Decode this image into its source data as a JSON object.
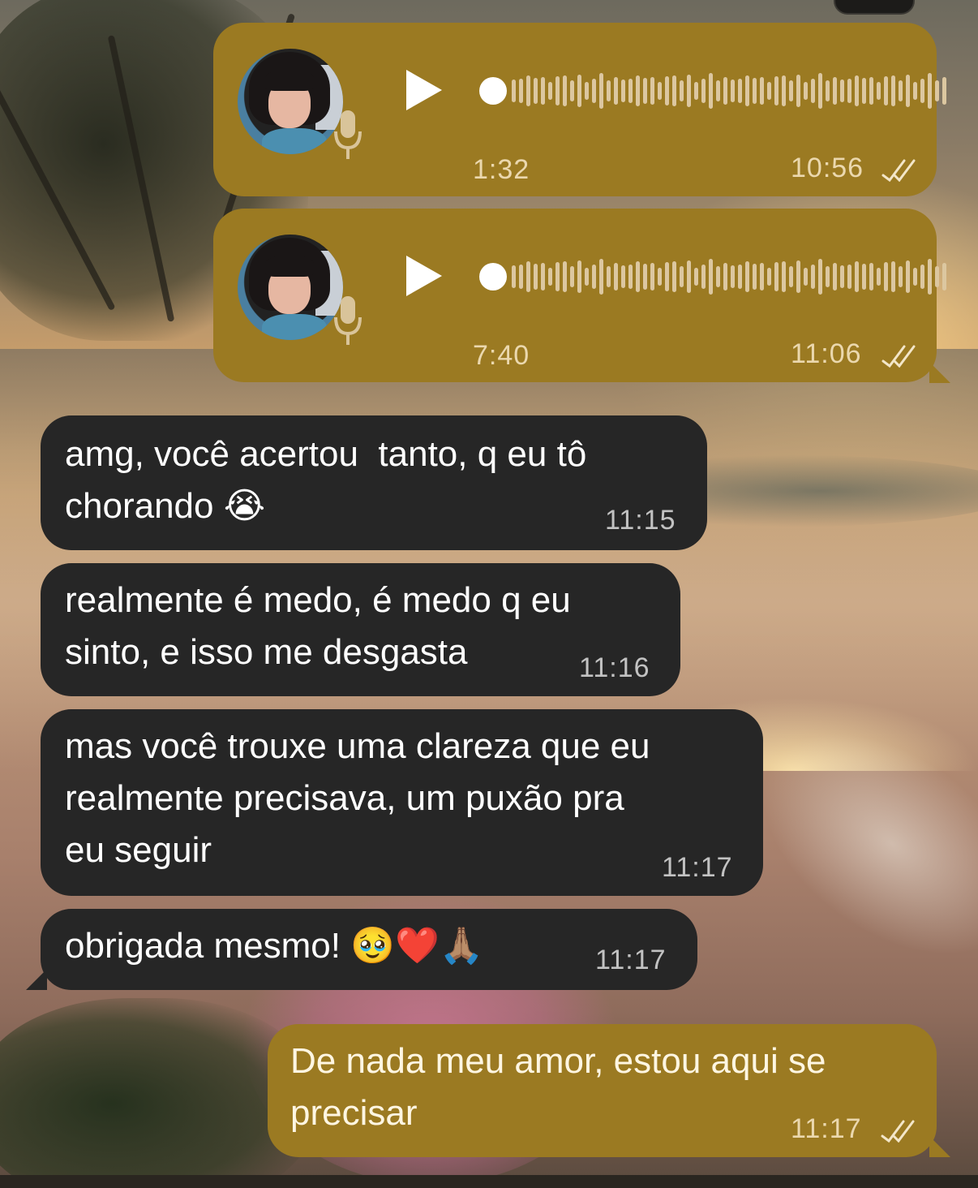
{
  "colors": {
    "outgoing_bubble": "#9b7a22",
    "incoming_bubble": "#262626",
    "text": "#ffffff",
    "waveform": "#dcc7a0"
  },
  "messages": [
    {
      "type": "voice",
      "direction": "outgoing",
      "duration": "1:32",
      "time": "10:56",
      "status": "double-check-icon",
      "progress": 0
    },
    {
      "type": "voice",
      "direction": "outgoing",
      "duration": "7:40",
      "time": "11:06",
      "status": "double-check-icon",
      "progress": 0
    },
    {
      "type": "text",
      "direction": "incoming",
      "text": "amg, você acertou  tanto, q eu tô\nchorando 😭",
      "time": "11:15"
    },
    {
      "type": "text",
      "direction": "incoming",
      "text": "realmente é medo, é medo q eu\nsinto, e isso me desgasta",
      "time": "11:16"
    },
    {
      "type": "text",
      "direction": "incoming",
      "text": "mas você trouxe uma clareza que eu\nrealmente precisava, um puxão pra\neu seguir",
      "time": "11:17"
    },
    {
      "type": "text",
      "direction": "incoming",
      "text": "obrigada mesmo! 🥹❤️🙏🏽",
      "time": "11:17"
    },
    {
      "type": "text",
      "direction": "outgoing",
      "text": "De nada meu amor, estou aqui se\nprecisar",
      "time": "11:17",
      "status": "double-check-icon"
    }
  ]
}
